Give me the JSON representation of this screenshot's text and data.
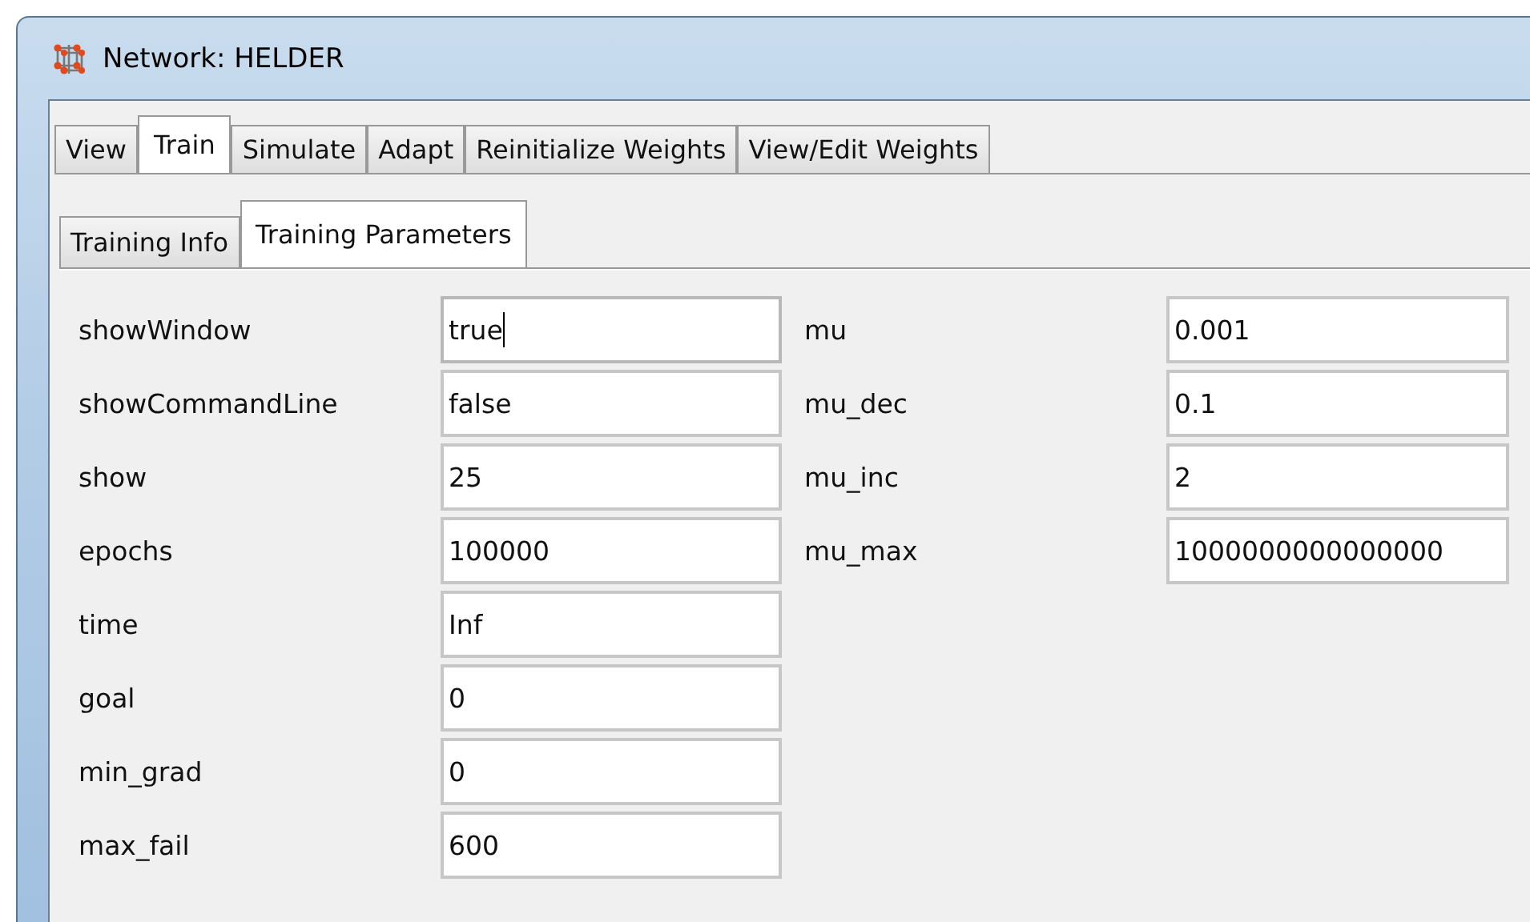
{
  "window": {
    "title": "Network: HELDER"
  },
  "tabs": [
    {
      "label": "View",
      "selected": false
    },
    {
      "label": "Train",
      "selected": true
    },
    {
      "label": "Simulate",
      "selected": false
    },
    {
      "label": "Adapt",
      "selected": false
    },
    {
      "label": "Reinitialize Weights",
      "selected": false
    },
    {
      "label": "View/Edit Weights",
      "selected": false
    }
  ],
  "subtabs": [
    {
      "label": "Training Info",
      "selected": false
    },
    {
      "label": "Training Parameters",
      "selected": true
    }
  ],
  "left_params": [
    {
      "label": "showWindow",
      "value": "true",
      "focused": true
    },
    {
      "label": "showCommandLine",
      "value": "false",
      "focused": false
    },
    {
      "label": "show",
      "value": "25",
      "focused": false
    },
    {
      "label": "epochs",
      "value": "100000",
      "focused": false
    },
    {
      "label": "time",
      "value": "Inf",
      "focused": false
    },
    {
      "label": "goal",
      "value": "0",
      "focused": false
    },
    {
      "label": "min_grad",
      "value": "0",
      "focused": false
    },
    {
      "label": "max_fail",
      "value": "600",
      "focused": false
    }
  ],
  "right_params": [
    {
      "label": "mu",
      "value": "0.001",
      "focused": false
    },
    {
      "label": "mu_dec",
      "value": "0.1",
      "focused": false
    },
    {
      "label": "mu_inc",
      "value": "2",
      "focused": false
    },
    {
      "label": "mu_max",
      "value": "1000000000000000",
      "focused": false
    }
  ]
}
